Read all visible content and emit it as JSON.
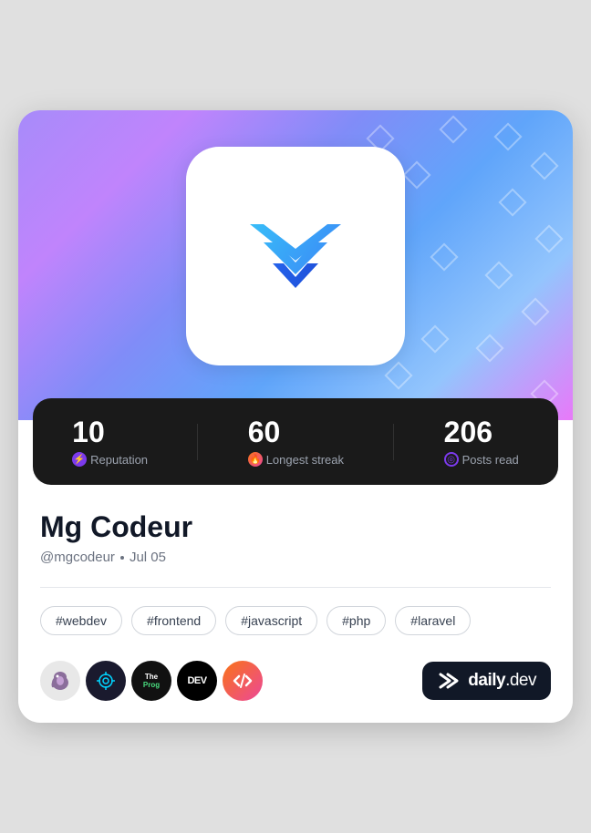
{
  "card": {
    "hero": {
      "alt": "Profile hero background"
    },
    "avatar": {
      "alt": "Mg Codeur avatar"
    },
    "stats": [
      {
        "key": "reputation",
        "value": "10",
        "label": "Reputation",
        "icon_type": "bolt",
        "icon_color": "purple"
      },
      {
        "key": "streak",
        "value": "60",
        "label": "Longest streak",
        "icon_type": "flame",
        "icon_color": "orange"
      },
      {
        "key": "posts_read",
        "value": "206",
        "label": "Posts read",
        "icon_type": "ring",
        "icon_color": "purple-outline"
      }
    ],
    "profile": {
      "display_name": "Mg Codeur",
      "username": "@mgcodeur",
      "join_date": "Jul 05"
    },
    "tags": [
      "#webdev",
      "#frontend",
      "#javascript",
      "#php",
      "#laravel"
    ],
    "source_icons": [
      {
        "key": "elephant",
        "label": "PHP Elephant"
      },
      {
        "key": "crosshair",
        "label": "Crosshair"
      },
      {
        "key": "theprg",
        "label": "The Programmer"
      },
      {
        "key": "dev",
        "label": "DEV"
      },
      {
        "key": "code",
        "label": "Code"
      }
    ],
    "branding": {
      "name": "daily",
      "suffix": ".dev",
      "logo_alt": "daily.dev logo"
    }
  }
}
